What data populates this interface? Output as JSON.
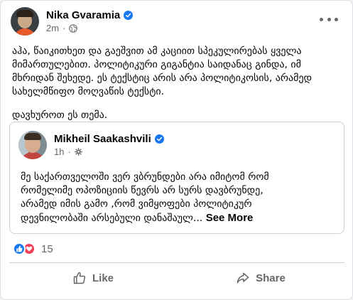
{
  "post": {
    "author": "Nika Gvaramia",
    "time": "2m",
    "separator": "·",
    "text_paragraphs": [
      "აჰა, წაიკითხეთ და გაეშვით ამ კაციით სპეკულირებას ყველა\nმიმართულებით. პოლიტიკური გიგანტია საიდანაც გინდა, იმ\nმხრიდან შეხედე. ეს ტექსტიც არის არა პოლიტიკოსის, არამედ\nსახელმწიფო მოღვაწის ტექსტი.",
      "დავხუროთ ეს თემა."
    ]
  },
  "shared_post": {
    "author": "Mikheil Saakashvili",
    "time": "1h",
    "separator": "·",
    "text": "მე საქართველოში ვერ ვბრუნდები არა იმიტომ რომ\nრომელიმე ოპოზიციის წევრს არ სურს დავბრუნდე,\nარამედ იმის გამო ,რომ ვიმყოფები პოლიტიკურ\nდევნილობაში არსებული დანაშაულ...",
    "see_more": "See More"
  },
  "reactions": {
    "count": "15",
    "types": [
      "like-icon",
      "love-icon"
    ]
  },
  "actions": {
    "like": "Like",
    "share": "Share"
  },
  "colors": {
    "facebook_blue": "#1877f2",
    "love_red": "#f33e58",
    "secondary_text": "#65676b"
  }
}
